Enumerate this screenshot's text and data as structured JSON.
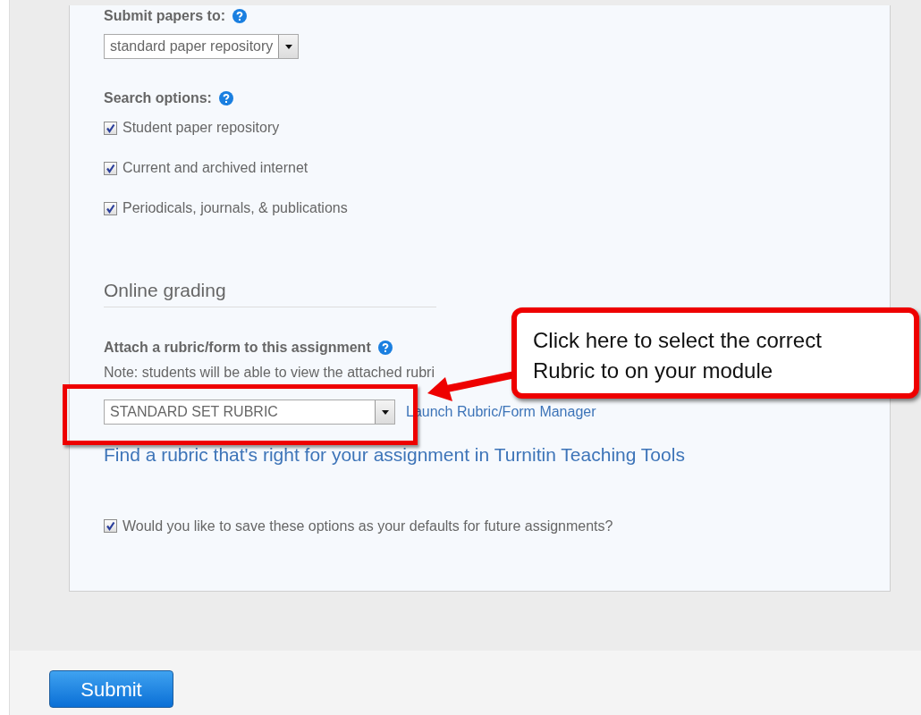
{
  "submit_papers": {
    "label": "Submit papers to:",
    "value": "standard paper repository"
  },
  "search_options": {
    "label": "Search options:",
    "options": [
      {
        "label": "Student paper repository",
        "checked": true
      },
      {
        "label": "Current and archived internet",
        "checked": true
      },
      {
        "label": "Periodicals, journals, & publications",
        "checked": true
      }
    ]
  },
  "online_grading": {
    "heading": "Online grading",
    "rubric_label": "Attach a rubric/form to this assignment",
    "note": "Note: students will be able to view the attached rubri",
    "rubric_select": "STANDARD SET RUBRIC",
    "manager_link": "Launch Rubric/Form Manager",
    "teaching_tools_link": "Find a rubric that's right for your assignment in Turnitin Teaching Tools"
  },
  "save_defaults": {
    "label": "Would you like to save these options as your defaults for future assignments?",
    "checked": true
  },
  "annotation": {
    "text": "Click here to select the correct\nRubric to on your module"
  },
  "submit_button": "Submit"
}
